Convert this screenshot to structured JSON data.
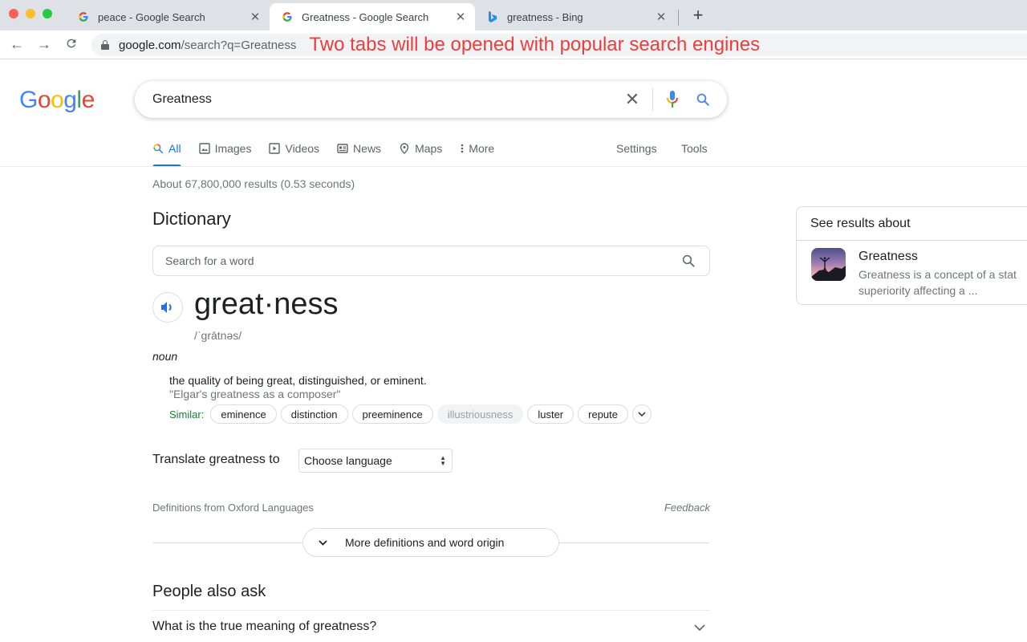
{
  "browser": {
    "tabs": [
      {
        "title": "peace - Google Search",
        "favicon": "google-g-icon",
        "active": false
      },
      {
        "title": "Greatness - Google Search",
        "favicon": "google-g-icon",
        "active": true
      },
      {
        "title": "greatness - Bing",
        "favicon": "bing-b-icon",
        "active": false
      }
    ],
    "close_glyph": "✕",
    "new_tab_glyph": "+",
    "nav": {
      "back": "←",
      "forward": "→",
      "reload": "C"
    },
    "url_host": "google.com",
    "url_path": "/search?q=Greatness",
    "annotation": "Two tabs will be opened with popular search engines"
  },
  "google": {
    "logo_letters": [
      {
        "ch": "G",
        "color": "#4285f4"
      },
      {
        "ch": "o",
        "color": "#ea4335"
      },
      {
        "ch": "o",
        "color": "#fbbc05"
      },
      {
        "ch": "g",
        "color": "#4285f4"
      },
      {
        "ch": "l",
        "color": "#34a853"
      },
      {
        "ch": "e",
        "color": "#ea4335"
      }
    ],
    "query": "Greatness",
    "clear_glyph": "✕",
    "nav_tabs": [
      {
        "label": "All",
        "icon": "search-icon",
        "active": true
      },
      {
        "label": "Images",
        "icon": "image-icon",
        "active": false
      },
      {
        "label": "Videos",
        "icon": "video-icon",
        "active": false
      },
      {
        "label": "News",
        "icon": "news-icon",
        "active": false
      },
      {
        "label": "Maps",
        "icon": "map-pin-icon",
        "active": false
      },
      {
        "label": "More",
        "icon": "more-vert-icon",
        "active": false
      }
    ],
    "settings_label": "Settings",
    "tools_label": "Tools",
    "result_stats": "About 67,800,000 results (0.53 seconds)"
  },
  "dictionary": {
    "title": "Dictionary",
    "search_placeholder": "Search for a word",
    "headword": "great·ness",
    "phonetic": "/ˈɡrātnəs/",
    "part_of_speech": "noun",
    "definition": "the quality of being great, distinguished, or eminent.",
    "example": "\"Elgar's greatness as a composer\"",
    "similar_label": "Similar:",
    "similar": [
      {
        "word": "eminence",
        "disabled": false
      },
      {
        "word": "distinction",
        "disabled": false
      },
      {
        "word": "preeminence",
        "disabled": false
      },
      {
        "word": "illustriousness",
        "disabled": true
      },
      {
        "word": "luster",
        "disabled": false
      },
      {
        "word": "repute",
        "disabled": false
      }
    ],
    "translate_label": "Translate greatness to",
    "translate_selected": "Choose language",
    "source": "Definitions from Oxford Languages",
    "feedback": "Feedback",
    "more_button": "More definitions and word origin"
  },
  "people_also_ask": {
    "title": "People also ask",
    "questions": [
      "What is the true meaning of greatness?"
    ]
  },
  "side_panel": {
    "header": "See results about",
    "item_title": "Greatness",
    "item_desc_line1": "Greatness is a concept of a stat",
    "item_desc_line2": "superiority affecting a ..."
  }
}
